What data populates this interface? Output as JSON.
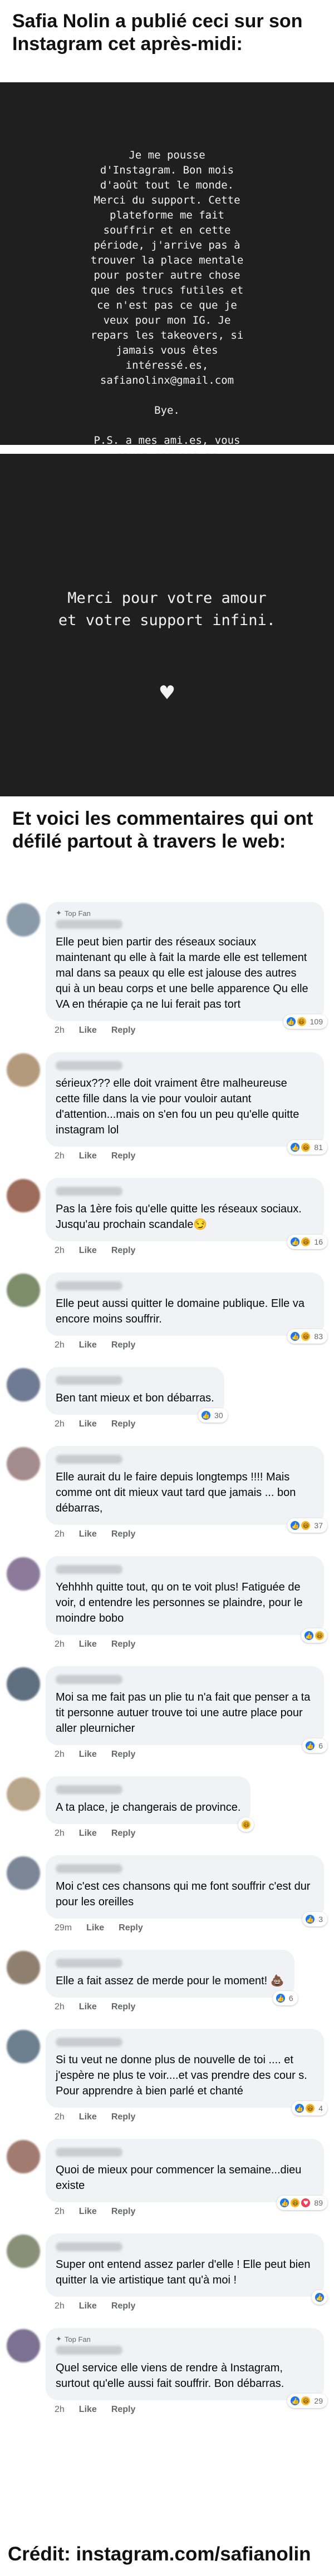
{
  "headline_top": "Safia Nolin a publié ceci sur son Instagram cet après-midi:",
  "story1": {
    "text": "Je me pousse\nd'Instagram. Bon mois\nd'août tout le monde.\nMerci du support. Cette\nplateforme me fait\nsouffrir et en cette\npériode, j'arrive pas à\ntrouver la place mentale\npour poster autre chose\nque des trucs futiles et\nce n'est pas ce que je\nveux pour mon IG. Je\nrepars les takeovers, si\njamais vous êtes\nintéressé.es,\nsafianolinx@gmail.com\n\nBye.\n\nP.S. a mes ami.es, vous\nsavez comment me\nrejoindre. je regarderai\npu mes dms."
  },
  "story2": {
    "text": "Merci pour votre amour\net votre support infini.",
    "heart": "♥"
  },
  "headline_mid": "Et voici les commentaires qui ont défilé partout à travers le web:",
  "labels": {
    "top_fan": "Top Fan",
    "like": "Like",
    "reply": "Reply"
  },
  "comments": [
    {
      "top_fan": true,
      "text": "Elle peut bien partir des réseaux sociaux maintenant qu elle à fait la marde elle est tellement mal dans sa peaux qu elle est jalouse des autres qui à un beau corps et une belle apparence  Qu elle VA en thérapie ça ne lui ferait pas tort",
      "time": "2h",
      "count": "109",
      "reacts": [
        "like",
        "laugh"
      ],
      "avatar": "#8a9aa8"
    },
    {
      "top_fan": false,
      "text": "sérieux??? elle doit vraiment être malheureuse cette fille dans la vie pour vouloir autant d'attention...mais on s'en fou un peu qu'elle quitte instagram lol",
      "time": "2h",
      "count": "81",
      "reacts": [
        "like",
        "laugh"
      ],
      "avatar": "#b49a7c"
    },
    {
      "top_fan": false,
      "text": "Pas la 1ère fois qu'elle quitte les réseaux sociaux. Jusqu'au prochain scandale😏",
      "time": "2h",
      "count": "16",
      "reacts": [
        "like",
        "laugh"
      ],
      "avatar": "#9c6b5a"
    },
    {
      "top_fan": false,
      "text": "Elle peut aussi quitter le domaine publique. Elle va encore moins souffrir.",
      "time": "2h",
      "count": "83",
      "reacts": [
        "like",
        "laugh"
      ],
      "avatar": "#7d8c6a"
    },
    {
      "top_fan": false,
      "text": "Ben tant mieux et bon débarras.",
      "time": "2h",
      "count": "30",
      "reacts": [
        "like"
      ],
      "avatar": "#6f7b92"
    },
    {
      "top_fan": false,
      "text": "Elle aurait du le faire depuis longtemps !!!! Mais comme ont dit mieux vaut tard que jamais ... bon débarras,",
      "time": "2h",
      "count": "37",
      "reacts": [
        "like",
        "laugh"
      ],
      "avatar": "#a48c8c"
    },
    {
      "top_fan": false,
      "text": "Yehhhh quitte tout, qu on te voit plus! Fatiguée de voir, d entendre les personnes se plaindre, pour le moindre bobo",
      "time": "2h",
      "count": "",
      "reacts": [
        "like",
        "laugh"
      ],
      "avatar": "#8b7a9a"
    },
    {
      "top_fan": false,
      "text": "Moi sa me fait pas un plie tu n'a fait que penser a ta tit personne autuer trouve toi une autre place pour aller pleurnicher",
      "time": "2h",
      "count": "6",
      "reacts": [
        "like"
      ],
      "avatar": "#5f6f80"
    },
    {
      "top_fan": false,
      "text": "A ta place, je changerais de province.",
      "time": "2h",
      "count": "",
      "reacts": [
        "laugh"
      ],
      "avatar": "#b8a58a"
    },
    {
      "top_fan": false,
      "text": "Moi c'est ces chansons qui me font souffrir c'est dur pour les oreilles",
      "time": "29m",
      "count": "3",
      "reacts": [
        "like"
      ],
      "avatar": "#7a8696"
    },
    {
      "top_fan": false,
      "text": "Elle a fait assez de merde pour le moment! 💩",
      "time": "2h",
      "count": "6",
      "reacts": [
        "like"
      ],
      "avatar": "#8f7f6f"
    },
    {
      "top_fan": false,
      "text": "Si tu veut ne donne plus  de nouvelle de toi .... et j'espère ne plus te voir....et vas prendre des cour s.  Pour apprendre à bien parlé  et chanté",
      "time": "2h",
      "count": "4",
      "reacts": [
        "like",
        "laugh"
      ],
      "avatar": "#6b7f8f"
    },
    {
      "top_fan": false,
      "text": "Quoi de mieux pour commencer la semaine...dieu existe",
      "time": "2h",
      "count": "89",
      "reacts": [
        "like",
        "laugh",
        "love"
      ],
      "avatar": "#a17a70"
    },
    {
      "top_fan": false,
      "text": "Super ont entend assez parler d'elle ! Elle peut bien quitter la vie artistique tant qu'à moi !",
      "time": "2h",
      "count": "",
      "reacts": [
        "like"
      ],
      "avatar": "#8a8f78"
    },
    {
      "top_fan": true,
      "text": "Quel service elle viens de rendre à Instagram, surtout qu'elle aussi fait souffrir. Bon débarras.",
      "time": "2h",
      "count": "29",
      "reacts": [
        "like",
        "laugh"
      ],
      "avatar": "#7d7090"
    }
  ],
  "credit": "Crédit: instagram.com/safianolin"
}
